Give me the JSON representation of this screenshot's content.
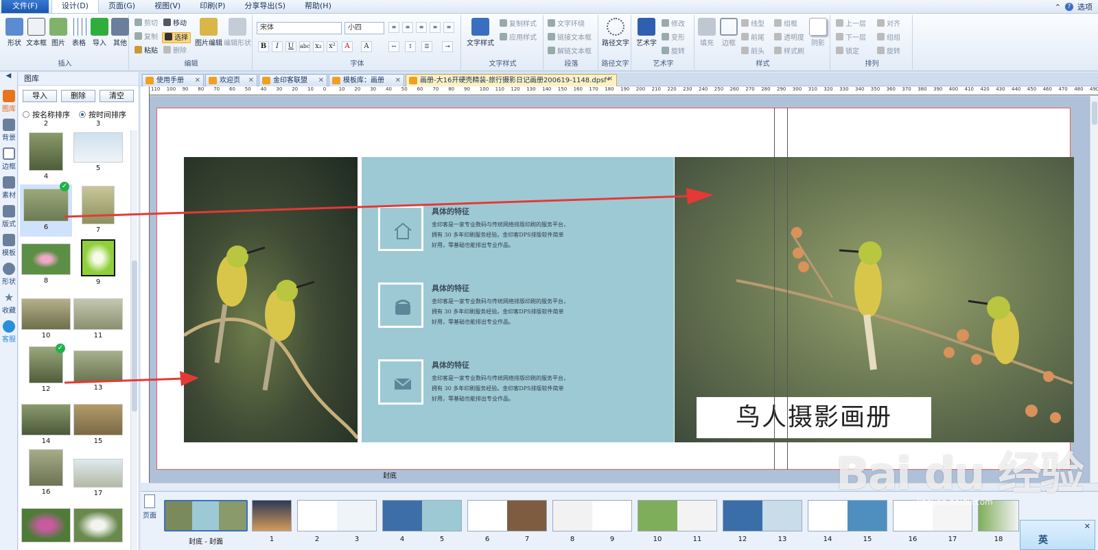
{
  "menu": {
    "tabs": [
      "文件(F)",
      "设计(D)",
      "页面(G)",
      "视图(V)",
      "印刷(P)",
      "分享导出(S)",
      "帮助(H)"
    ],
    "active": 1,
    "options": "选项"
  },
  "ribbon": {
    "insert": {
      "buttons": [
        "形状",
        "文本框",
        "图片",
        "表格",
        "导入",
        "其他"
      ],
      "label": "插入"
    },
    "edit": {
      "items": [
        "剪切",
        "移动",
        "复制",
        "选择",
        "粘贴",
        "删除"
      ],
      "img_edit": "图片编辑",
      "shape_edit": "编辑形状",
      "label": "编辑"
    },
    "font": {
      "family": "宋体",
      "size": "小四",
      "label": "字体",
      "format": [
        "B",
        "I",
        "U",
        "abc",
        "x₂",
        "x²",
        "A",
        "A"
      ]
    },
    "text_style": {
      "big": "文字样式",
      "copy": "复制样式",
      "apply": "应用样式",
      "label": "文字样式"
    },
    "paragraph": {
      "items": [
        "文字环绕",
        "链接文本框",
        "解链文本框"
      ],
      "label": "段落"
    },
    "path_text": {
      "big": "路径文字",
      "label": "路径文字"
    },
    "art_text": {
      "big": "艺术字",
      "items": [
        "修改",
        "变形",
        "旋转"
      ],
      "label": "艺术字"
    },
    "style": {
      "fill": "填充",
      "border": "边框",
      "items": [
        "线型",
        "组框",
        "前尾",
        "透明度",
        "前头",
        "样式刷"
      ],
      "shadow": "阴影",
      "label": "样式"
    },
    "arrange": {
      "items": [
        "上一层",
        "对齐",
        "下一层",
        "组组",
        "锁定",
        "旋转"
      ],
      "label": "排列"
    }
  },
  "rail": [
    "图库",
    "背景",
    "边框",
    "素材",
    "版式",
    "模板",
    "形状",
    "收藏",
    "客服"
  ],
  "gallery": {
    "title": "图库",
    "buttons": [
      "导入",
      "删除",
      "清空"
    ],
    "sort": [
      "按名称排序",
      "按时间排序"
    ],
    "thumbs": [
      "2",
      "3",
      "4",
      "5",
      "6",
      "7",
      "8",
      "9",
      "10",
      "11",
      "12",
      "13",
      "14",
      "15",
      "16",
      "17"
    ]
  },
  "tabs": [
    "使用手册",
    "欢迎页",
    "金印客联盟",
    "模板库：画册",
    "画册-大16开硬壳精装-旅行摄影日记画册200619-1148.dpsf*"
  ],
  "ruler": [
    "110",
    "100",
    "90",
    "80",
    "70",
    "60",
    "50",
    "40",
    "30",
    "20",
    "10",
    "0",
    "10",
    "20",
    "30",
    "40",
    "50",
    "60",
    "70",
    "80",
    "90",
    "100",
    "110",
    "120",
    "130",
    "140",
    "150",
    "160",
    "170",
    "180",
    "190",
    "200",
    "210",
    "220",
    "230",
    "240",
    "250",
    "260",
    "270",
    "280",
    "290",
    "300",
    "310",
    "320",
    "330",
    "340",
    "350",
    "360",
    "370",
    "380",
    "390",
    "400",
    "410",
    "420",
    "430",
    "440",
    "450",
    "460",
    "470",
    "480",
    "490"
  ],
  "features": [
    {
      "title": "具体的特征",
      "body": "金印客是一家专业数码与传统网络排版印刷的服务平台，拥有 30 多年印刷服务经验。金印客DPS排版软件简单好用，零基础也能排出专业作品。",
      "icon": "house-icon"
    },
    {
      "title": "具体的特征",
      "body": "金印客是一家专业数码与传统网络排版印刷的服务平台，拥有 30 多年印刷服务经验。金印客DPS排版软件简单好用，零基础也能排出专业作品。",
      "icon": "phone-icon"
    },
    {
      "title": "具体的特征",
      "body": "金印客是一家专业数码与传统网络排版印刷的服务平台，拥有 30 多年印刷服务经验。金印客DPS排版软件简单好用，零基础也能排出专业作品。",
      "icon": "mail-icon"
    }
  ],
  "cover_title": "鸟人摄影画册",
  "page_label": "封底",
  "strip": {
    "side_label": "页面",
    "pages": [
      "封底 - 封面",
      "1",
      "2",
      "3",
      "4",
      "5",
      "6",
      "7",
      "8",
      "9",
      "10",
      "11",
      "12",
      "13",
      "14",
      "15",
      "16",
      "17",
      "18"
    ]
  },
  "watermark": {
    "text": "Bai du 经验",
    "url": "jingyan.baidu.com"
  },
  "ime": "英"
}
